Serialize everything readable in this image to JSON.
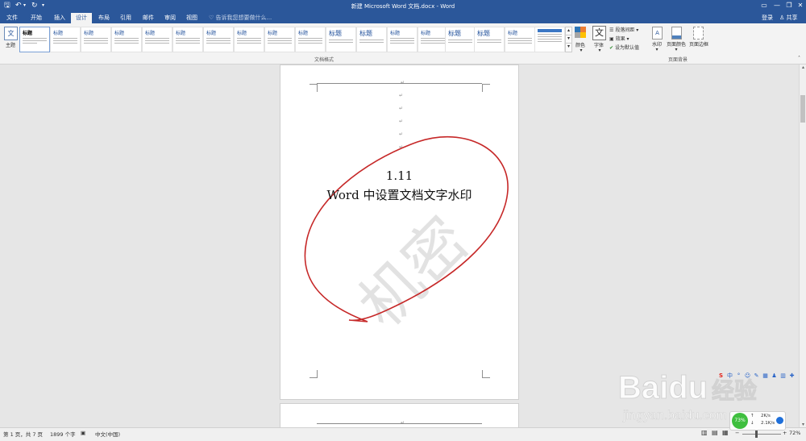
{
  "titlebar": {
    "title": "新建 Microsoft Word 文档.docx - Word",
    "save_icon": "save-icon",
    "undo_icon": "undo-icon",
    "redo_icon": "redo-icon",
    "customize_icon": "customize-qat-icon",
    "controls": {
      "ribbon_display": "▭",
      "minimize": "—",
      "maximize": "❐",
      "close": "✕"
    }
  },
  "tabs": [
    "文件",
    "开始",
    "插入",
    "设计",
    "布局",
    "引用",
    "邮件",
    "审阅",
    "视图"
  ],
  "active_tab": "设计",
  "tellme_placeholder": "告诉我您想要做什么...",
  "account": {
    "login": "登录",
    "share": "共享"
  },
  "ribbon": {
    "themes_label": "主题",
    "gallery_heading_samples": [
      "标题",
      "标题",
      "标题",
      "标题",
      "标题",
      "标题",
      "标题",
      "标题",
      "标题",
      "标题",
      "标题",
      "标题",
      "标题",
      "标题",
      "标题",
      "标题",
      "标题"
    ],
    "group_label_format": "文档格式",
    "colors_label": "颜色",
    "fonts_label": "字体",
    "paragraph_spacing": "段落间距",
    "effects": "效果",
    "set_default": "设为默认值",
    "watermark": "水印",
    "page_color": "页面颜色",
    "page_borders": "页面边框",
    "group_label_background": "页面背景",
    "font_icon_glyph": "文"
  },
  "document": {
    "para_mark": "↵",
    "heading_line1": "1.11",
    "heading_line2": "Word 中设置文档文字水印",
    "watermark_text": "机密",
    "annotation_color": "#c62828"
  },
  "statusbar": {
    "page_info": "第 1 页，共 7 页",
    "word_count": "1899 个字",
    "language": "中文(中国)",
    "zoom": "72%",
    "zoom_level": 0.72
  },
  "widget": {
    "percent": "73%",
    "up_speed": "2K/s",
    "down_speed": "2.1K/s"
  },
  "ime_bar": [
    "S",
    "中",
    "°",
    "☺",
    "✎",
    "▦",
    "♟",
    "▥",
    "✚"
  ],
  "brand": {
    "logo_text": "Baidu",
    "logo_cn": "经验",
    "url": "jingyan.baidu.com"
  }
}
